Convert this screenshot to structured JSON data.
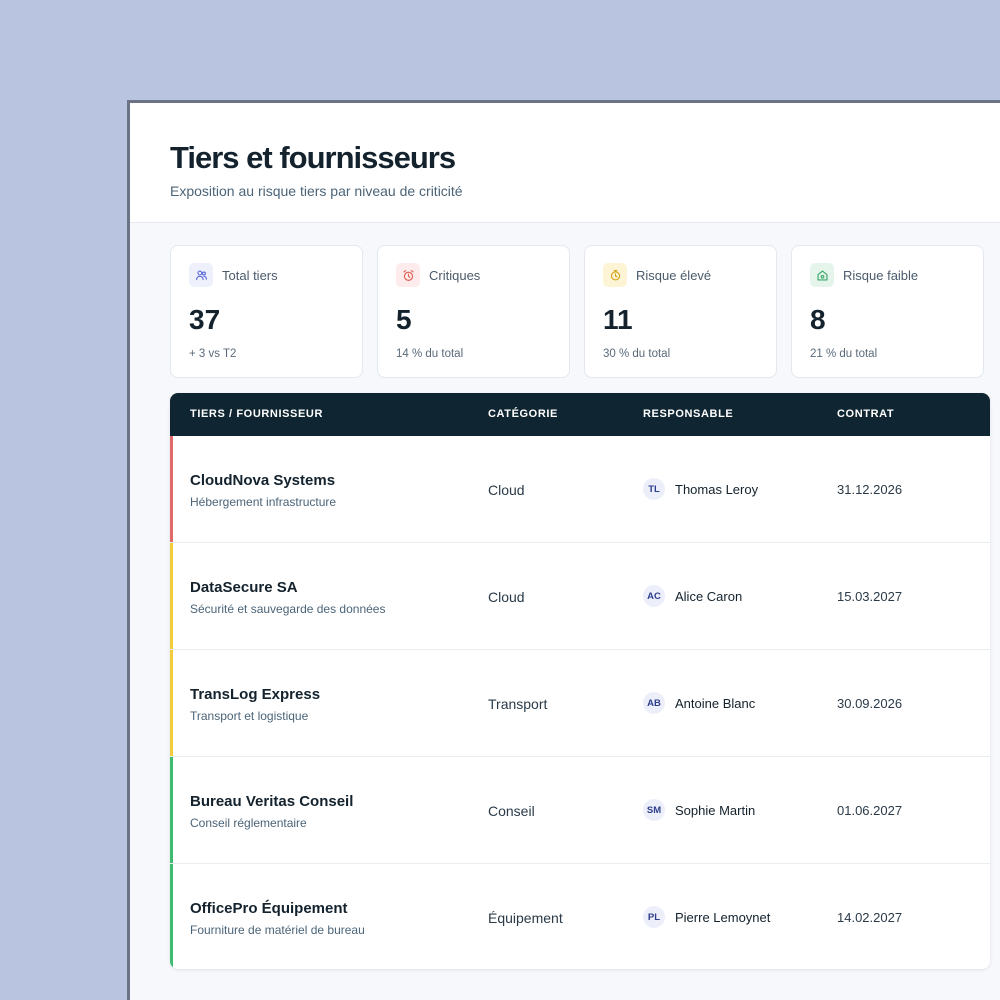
{
  "header": {
    "title": "Tiers et fournisseurs",
    "subtitle": "Exposition au risque tiers par niveau de criticité"
  },
  "cards": [
    {
      "label": "Total tiers",
      "value": "37",
      "note": "+ 3 vs T2",
      "icon": "users-icon",
      "color": "#5b6bd6",
      "bg": "#eef0fb"
    },
    {
      "label": "Critiques",
      "value": "5",
      "note": "14 % du total",
      "icon": "alarm-clock-icon",
      "color": "#e0625a",
      "bg": "#fdeceb"
    },
    {
      "label": "Risque élevé",
      "value": "11",
      "note": "30 % du total",
      "icon": "clock-warning-icon",
      "color": "#d4a216",
      "bg": "#fdf4d6"
    },
    {
      "label": "Risque faible",
      "value": "8",
      "note": "21 % du total",
      "icon": "shield-home-icon",
      "color": "#3aa767",
      "bg": "#e6f5ec"
    }
  ],
  "table": {
    "headers": [
      "TIERS / FOURNISSEUR",
      "CATÉGORIE",
      "RESPONSABLE",
      "CONTRAT"
    ],
    "rows": [
      {
        "name": "CloudNova Systems",
        "desc": "Hébergement infrastructure",
        "category": "Cloud",
        "initials": "TL",
        "owner": "Thomas Leroy",
        "date": "31.12.2026",
        "risk_color": "#e06a6a"
      },
      {
        "name": "DataSecure SA",
        "desc": "Sécurité et sauvegarde des données",
        "category": "Cloud",
        "initials": "AC",
        "owner": "Alice Caron",
        "date": "15.03.2027",
        "risk_color": "#f2cc3d"
      },
      {
        "name": "TransLog Express",
        "desc": "Transport et logistique",
        "category": "Transport",
        "initials": "AB",
        "owner": "Antoine Blanc",
        "date": "30.09.2026",
        "risk_color": "#f2cc3d"
      },
      {
        "name": "Bureau Veritas Conseil",
        "desc": "Conseil réglementaire",
        "category": "Conseil",
        "initials": "SM",
        "owner": "Sophie Martin",
        "date": "01.06.2027",
        "risk_color": "#3dbb6e"
      },
      {
        "name": "OfficePro Équipement",
        "desc": "Fourniture de matériel de bureau",
        "category": "Équipement",
        "initials": "PL",
        "owner": "Pierre Lemoynet",
        "date": "14.02.2027",
        "risk_color": "#3dbb6e"
      }
    ]
  }
}
